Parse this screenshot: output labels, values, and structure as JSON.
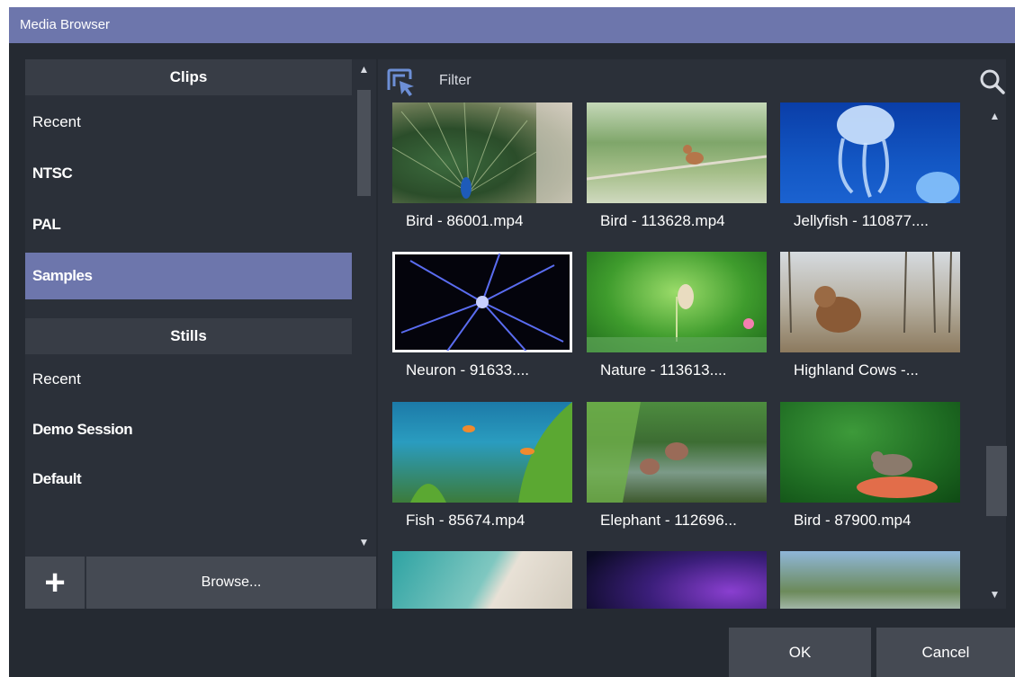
{
  "window": {
    "title": "Media Browser"
  },
  "left": {
    "clips_header": "Clips",
    "clips": [
      {
        "label": "Recent"
      },
      {
        "label": "NTSC"
      },
      {
        "label": "PAL"
      },
      {
        "label": "Samples",
        "selected": true
      }
    ],
    "stills_header": "Stills",
    "stills": [
      {
        "label": "Recent"
      },
      {
        "label": "Demo Session"
      },
      {
        "label": "Default"
      }
    ],
    "add_label": "+",
    "browse_label": "Browse..."
  },
  "right": {
    "filter_label": "Filter",
    "filter_icon": "select-filter-icon",
    "search_icon": "search-icon",
    "tiles": [
      {
        "caption": "Bird - 86001.mp4"
      },
      {
        "caption": "Bird - 113628.mp4"
      },
      {
        "caption": "Jellyfish - 110877...."
      },
      {
        "caption": "Neuron - 91633....",
        "selected": true
      },
      {
        "caption": "Nature - 113613...."
      },
      {
        "caption": "Highland Cows -..."
      },
      {
        "caption": "Fish - 85674.mp4"
      },
      {
        "caption": "Elephant - 112696..."
      },
      {
        "caption": "Bird - 87900.mp4"
      },
      {
        "caption": ""
      },
      {
        "caption": ""
      },
      {
        "caption": ""
      }
    ]
  },
  "footer": {
    "ok_label": "OK",
    "cancel_label": "Cancel"
  },
  "colors": {
    "accent": "#6d76ac",
    "background": "#252a32",
    "panel": "#2b3039",
    "button": "#454a53"
  }
}
